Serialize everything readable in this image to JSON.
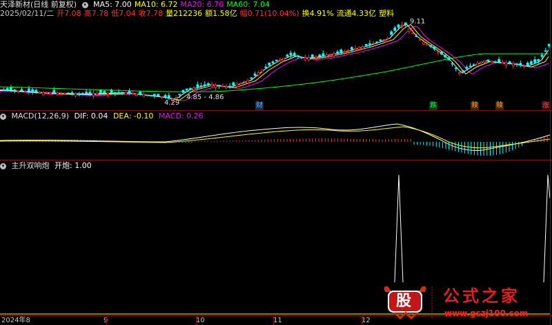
{
  "main_panel": {
    "title": "天泽新材(日线 前复权)",
    "ma_labels": [
      {
        "text": "MA5: 7.00",
        "color": "#ffffff"
      },
      {
        "text": "MA10: 6.72",
        "color": "#ffff00"
      },
      {
        "text": "MA20: 6.70",
        "color": "#ff00ff"
      },
      {
        "text": "MA60: 7.04",
        "color": "#00ff00"
      }
    ],
    "info": [
      {
        "text": "2025/02/11/二",
        "color": "#c8c8c8"
      },
      {
        "text": "开7.08",
        "color": "#ff3030"
      },
      {
        "text": "高7.78",
        "color": "#ff3030"
      },
      {
        "text": "低7.04",
        "color": "#ff3030"
      },
      {
        "text": "收7.78",
        "color": "#ff3030"
      },
      {
        "text": "量212236",
        "color": "#ffff00"
      },
      {
        "text": "额1.58亿",
        "color": "#ffff00"
      },
      {
        "text": "幅0.71(10.04%)",
        "color": "#ff3030"
      },
      {
        "text": "换4.91%",
        "color": "#ffff00"
      },
      {
        "text": "流通4.33亿",
        "color": "#ffff00"
      },
      {
        "text": "塑料",
        "color": "#ffff00"
      }
    ],
    "price_labels": {
      "high": "9.11",
      "low": "4.29",
      "range": "4.85 - 4.86"
    },
    "markers": [
      {
        "text": "财",
        "color": "#4db8ff",
        "bg": "#1a2a44"
      },
      {
        "text": "跌",
        "color": "#00ff40",
        "bg": "#0d3318"
      },
      {
        "text": "赎",
        "color": "#ffaa33",
        "bg": "#3a2208"
      },
      {
        "text": "赎",
        "color": "#ffaa33",
        "bg": "#3a2208"
      },
      {
        "text": "涨",
        "color": "#ff5050",
        "bg": "#3a0d0d"
      }
    ]
  },
  "macd_panel": {
    "title": "MACD(12,26,9)",
    "dif": "DIF: 0.04",
    "dea": "DEA: -0.10",
    "macd": "MACD: 0.26"
  },
  "signal_panel": {
    "title": "主升双响炮",
    "value": "开炮: 1.00"
  },
  "x_axis": [
    "2024年8",
    "9",
    "10",
    "11",
    "12"
  ],
  "watermark": {
    "logo_text": "股",
    "name": "公式之家",
    "url": "www.gszj100.com"
  },
  "colors": {
    "up": "#ff3030",
    "down": "#00ffff",
    "ma5": "#ffffff",
    "ma10": "#ffff00",
    "ma20": "#ff00ff",
    "ma60": "#00ff00",
    "grid": "#7a1010"
  }
}
